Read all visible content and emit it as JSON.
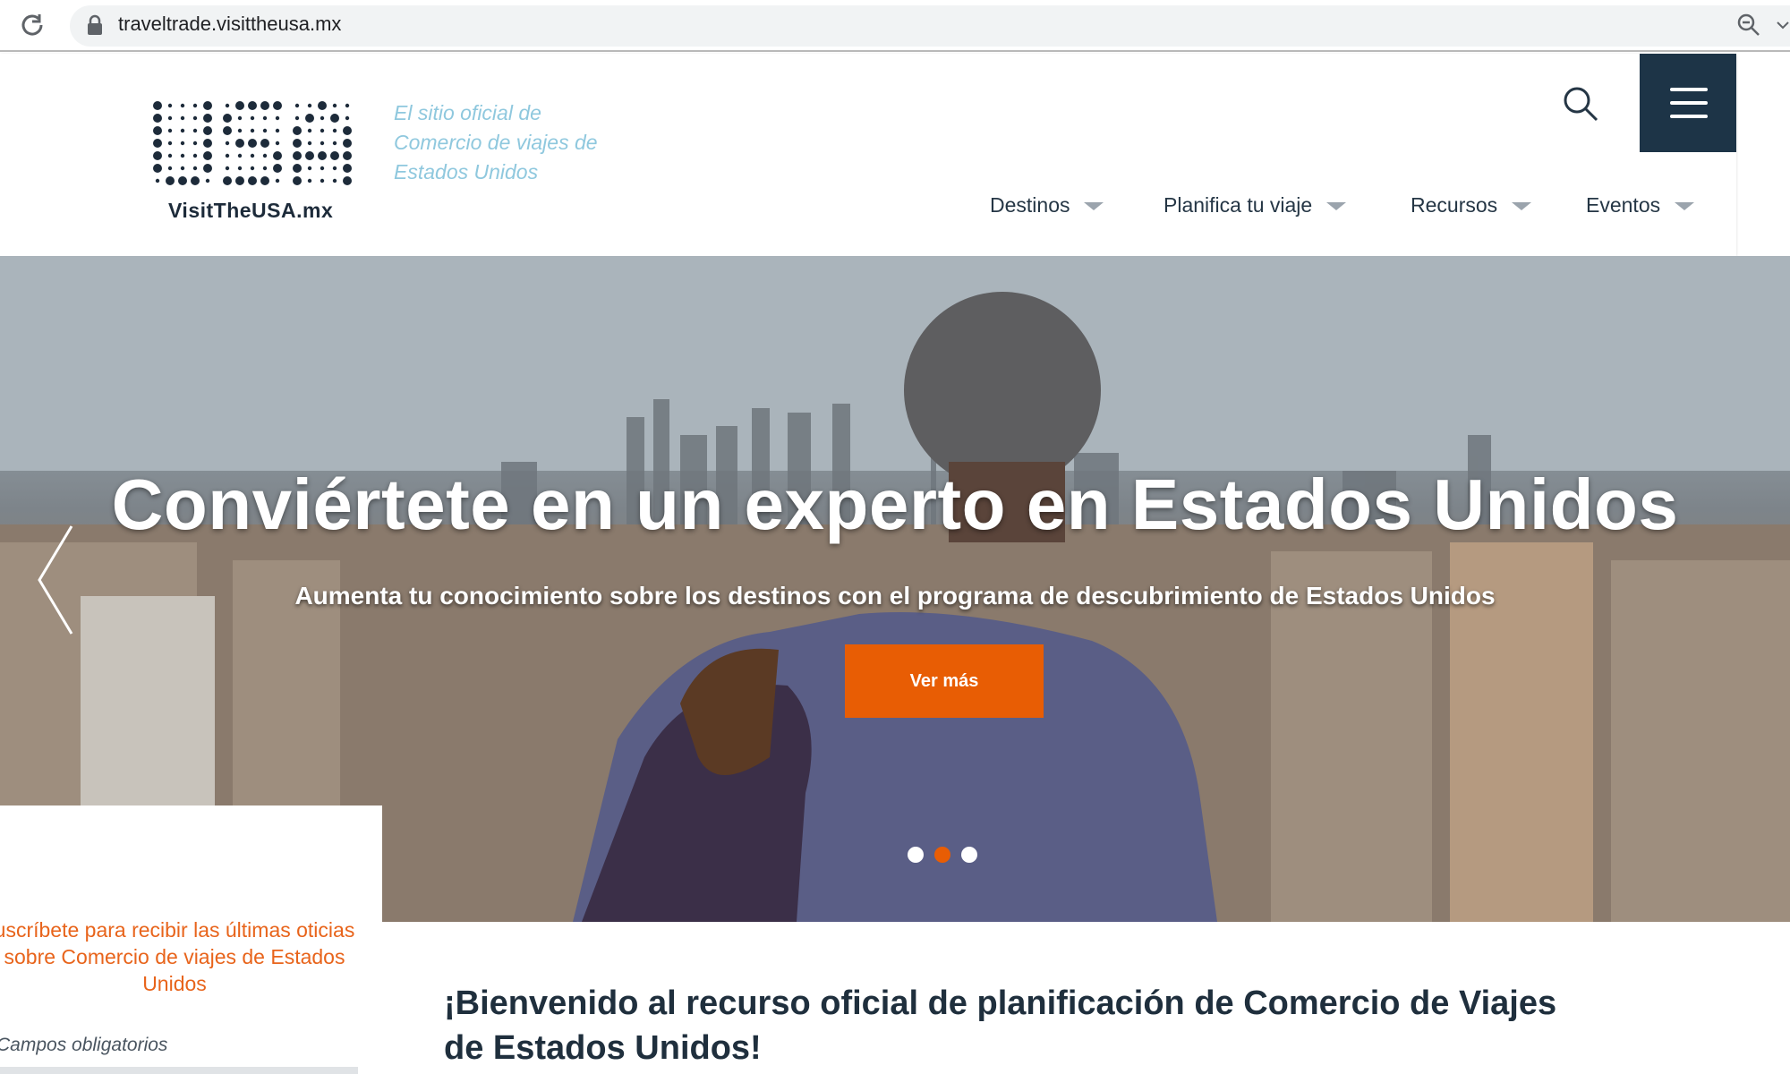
{
  "browser": {
    "url": "traveltrade.visittheusa.mx"
  },
  "header": {
    "logo_text": "VisitTheUSA.mx",
    "tagline": "El sitio oficial de Comercio de viajes de Estados Unidos",
    "nav": [
      {
        "label": "Destinos"
      },
      {
        "label": "Planifica tu viaje"
      },
      {
        "label": "Recursos"
      },
      {
        "label": "Eventos"
      }
    ]
  },
  "hero": {
    "title": "Conviértete en un experto en Estados Unidos",
    "subtitle": "Aumenta tu conocimiento sobre los destinos con el programa de descubrimiento de Estados Unidos",
    "cta_label": "Ver más",
    "slides_total": 3,
    "active_slide": 2
  },
  "subscribe": {
    "text": "uscríbete para recibir las últimas oticias sobre Comercio de viajes de Estados Unidos",
    "required_note": "Campos obligatorios"
  },
  "welcome": {
    "heading": "¡Bienvenido al recurso oficial de planificación de Comercio de Viajes de Estados Unidos!"
  },
  "colors": {
    "accent": "#e85d04",
    "navy": "#1d3447",
    "tagline": "#8fc8de"
  }
}
